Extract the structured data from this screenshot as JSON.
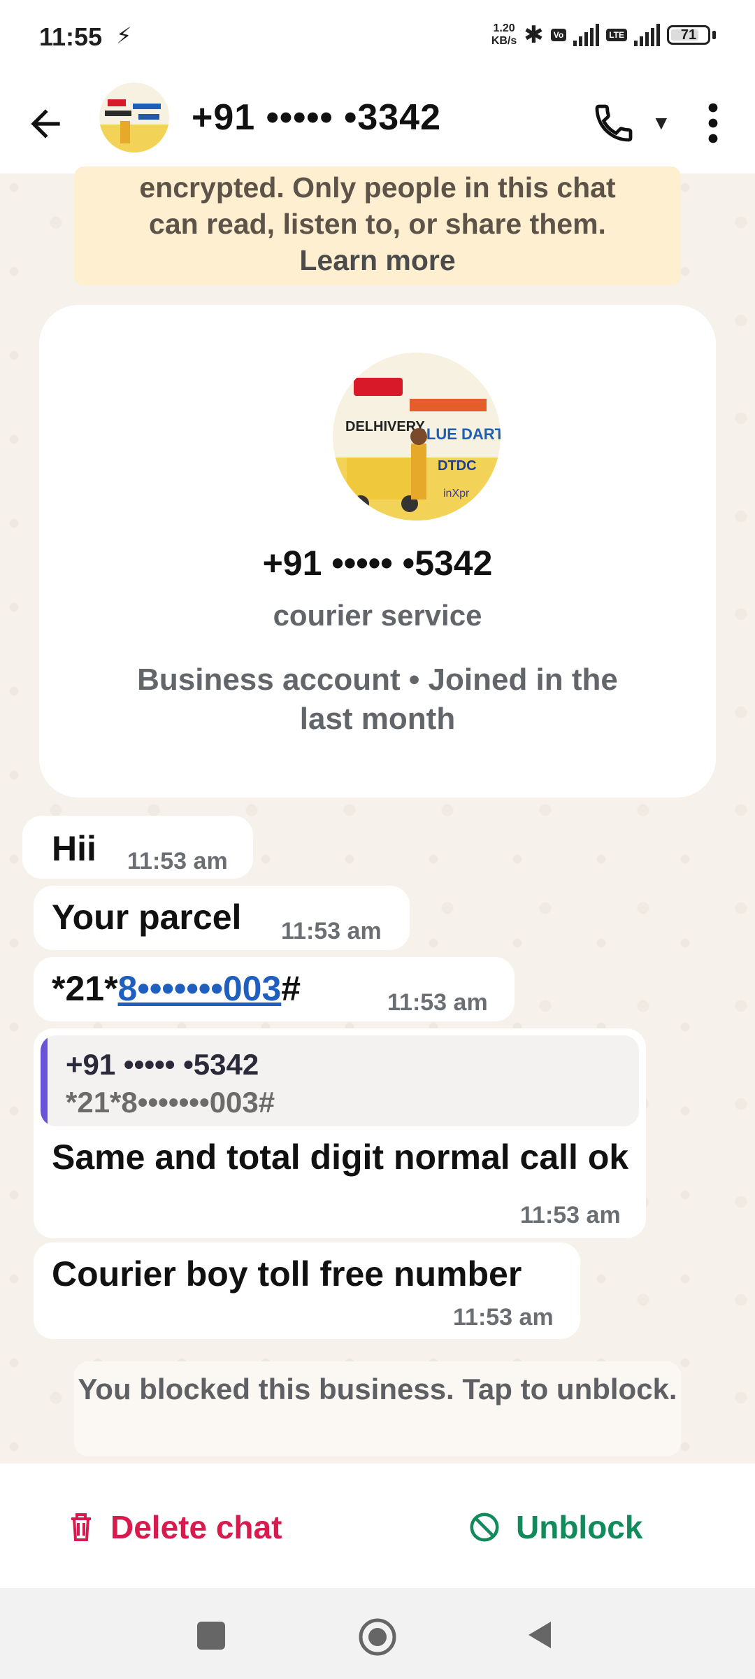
{
  "status_bar": {
    "time": "11:55",
    "speed": "1.20\nKB/s",
    "battery": "71"
  },
  "header": {
    "title": "+91 ••••• •3342",
    "avatar_label": "courier logos"
  },
  "encryption_notice": {
    "line1": "encrypted. Only people in this chat",
    "line2": "can read, listen to, or share them.",
    "learn_more": "Learn more"
  },
  "business_card": {
    "name": "+91 ••••• •5342",
    "description": "courier service",
    "meta": "Business account • Joined in the last month"
  },
  "messages": [
    {
      "text": "Hii",
      "time": "11:53 am"
    },
    {
      "text": "Your parcel",
      "time": "11:53 am"
    },
    {
      "text_prefix": "*21*",
      "link": "8•••••••003",
      "text_suffix": "#",
      "time": "11:53 am"
    },
    {
      "quote_name": "+91 ••••• •5342",
      "quote_text": "*21*8•••••••003#",
      "text": "Same and total digit normal call ok",
      "time": "11:53 am"
    },
    {
      "text": "Courier boy toll free number",
      "time": "11:53 am"
    }
  ],
  "blocked_notice": "You blocked this business. Tap to unblock.",
  "actions": {
    "delete": "Delete chat",
    "unblock": "Unblock"
  },
  "colors": {
    "delete": "#d81b4f",
    "unblock": "#128b5c",
    "quote_bar": "#6a53d6",
    "link": "#1f5fbf",
    "notice_bg": "#fdefd0"
  }
}
